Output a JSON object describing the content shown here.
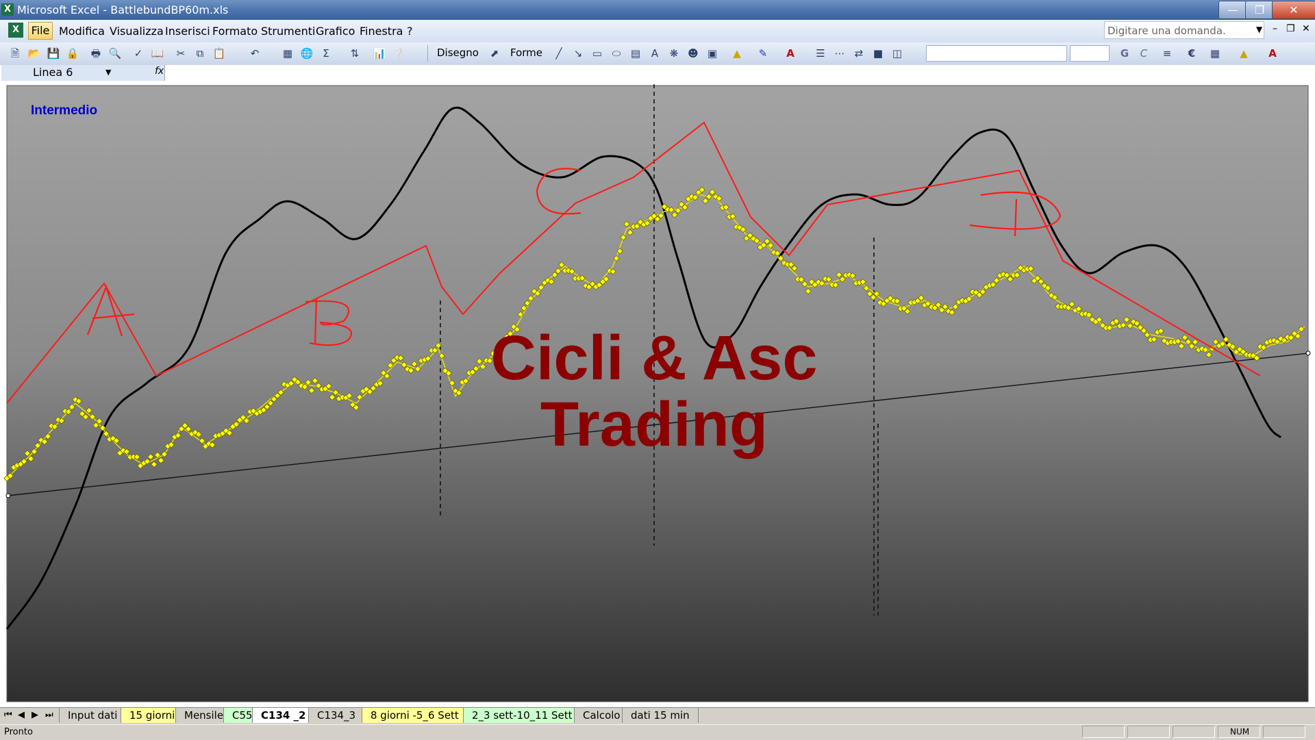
{
  "window": {
    "title": "Microsoft Excel - BattlebundBP60m.xls",
    "icon": "excel-icon"
  },
  "menu": {
    "items": [
      "File",
      "Modifica",
      "Visualizza",
      "Inserisci",
      "Formato",
      "Strumenti",
      "Grafico",
      "Finestra",
      "?"
    ],
    "ask_placeholder": "Digitare una domanda."
  },
  "toolbar": {
    "draw_label": "Disegno",
    "shapes_label": "Forme",
    "euro_symbol": "€"
  },
  "formula_bar": {
    "name_box": "Linea 6",
    "fx": "fx"
  },
  "chart": {
    "label": "Intermedio",
    "watermark_line1": "Cicli & Asc",
    "watermark_line2": "Trading",
    "annotations": [
      "A",
      "B",
      "C",
      "D"
    ],
    "colors": {
      "price": "#ffff00",
      "cycle": "#000000",
      "trend": "#ff0000",
      "watermark": "#8b0000",
      "label": "#0000cc"
    }
  },
  "chart_data": {
    "type": "line",
    "title": "",
    "xlabel": "",
    "ylabel": "",
    "series": [],
    "annotations": [
      "A",
      "B",
      "C",
      "D"
    ]
  },
  "sheet_tabs": [
    "Input dati",
    "15 giorni",
    "Mensile",
    "C55",
    "C134 _2",
    "C134_3",
    "8 giorni -5_6 Sett",
    "2_3 sett-10_11 Sett",
    "Calcolo",
    "dati 15 min"
  ],
  "active_tab": "C134 _2",
  "status": {
    "text": "Pronto",
    "num": "NUM"
  }
}
